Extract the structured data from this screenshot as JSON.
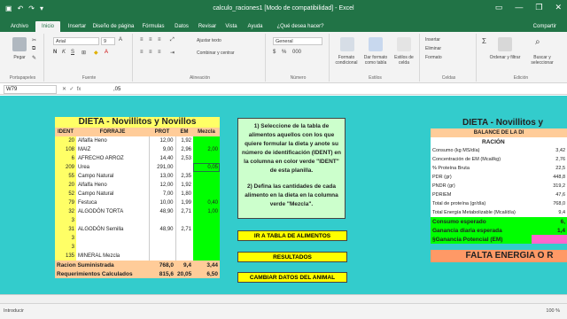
{
  "window": {
    "title": "calculo_raciones1 [Modo de compatibilidad] - Excel",
    "share": "Compartir"
  },
  "ribbon_tabs": [
    "Archivo",
    "Inicio",
    "Insertar",
    "Diseño de página",
    "Fórmulas",
    "Datos",
    "Revisar",
    "Vista",
    "Ayuda",
    "¿Qué desea hacer?"
  ],
  "ribbon": {
    "paste": "Pegar",
    "clipboard": "Portapapeles",
    "font_name": "Arial",
    "font_size": "9",
    "font_group": "Fuente",
    "wrap": "Ajustar texto",
    "merge": "Combinar y centrar",
    "align_group": "Alineación",
    "number_format": "General",
    "number_group": "Número",
    "cond_format": "Formato condicional",
    "table_format": "Dar formato como tabla",
    "cell_styles": "Estilos de celda",
    "styles_group": "Estilos",
    "insert": "Insertar",
    "delete": "Eliminar",
    "format": "Formato",
    "cells_group": "Celdas",
    "sort": "Ordenar y filtrar",
    "find": "Buscar y seleccionar",
    "edit_group": "Edición"
  },
  "formula_bar": {
    "name_box": "W79",
    "formula": ",05"
  },
  "diet": {
    "title": "DIETA - Novillitos y Novillos",
    "headers": [
      "IDENT",
      "FORRAJE",
      "PROT",
      "EM",
      "Mezcla"
    ],
    "rows": [
      [
        "20",
        "Alfalfa Heno",
        "12,00",
        "1,92",
        ""
      ],
      [
        "108",
        "MAIZ",
        "9,00",
        "2,96",
        "2,00"
      ],
      [
        "6",
        "AFRECHO ARROZ",
        "14,40",
        "2,53",
        ""
      ],
      [
        "209",
        "Urea",
        "291,00",
        "",
        "0,05"
      ],
      [
        "55",
        "Campo Natural",
        "13,00",
        "2,35",
        ""
      ],
      [
        "20",
        "Alfalfa Heno",
        "12,00",
        "1,92",
        ""
      ],
      [
        "52",
        "Campo Natural",
        "7,00",
        "1,80",
        ""
      ],
      [
        "79",
        "Festuca",
        "10,00",
        "1,99",
        "0,40"
      ],
      [
        "32",
        "ALGODÓN TORTA",
        "48,90",
        "2,71",
        "1,00"
      ],
      [
        "3",
        "",
        "",
        "",
        ""
      ],
      [
        "31",
        "ALGODÓN Semilla",
        "48,90",
        "2,71",
        ""
      ],
      [
        "3",
        "",
        "",
        "",
        ""
      ],
      [
        "3",
        "",
        "",
        "",
        ""
      ],
      [
        "135",
        "MINERAL Mezcla",
        "",
        "",
        ""
      ]
    ],
    "supplied_label": "Racion Suministrada",
    "supplied": [
      "768,0",
      "9,4",
      "3,44"
    ],
    "required_label": "Requerimientos Calculados",
    "required": [
      "815,6",
      "20,05",
      "6,50"
    ]
  },
  "instructions": {
    "p1": "1) Seleccione de la tabla de alimentos aquellos con los que quiere formular la dieta y anote su número de identificación (IDENT) en la columna en color verde \"IDENT\" de esta planilla.",
    "p2": "2) Defina las cantidades de cada alimento en la dieta en la columna verde \"Mezcla\"."
  },
  "buttons": {
    "tabla": "IR A TABLA DE ALIMENTOS",
    "resultados": "RESULTADOS",
    "cambiar": "CAMBIAR DATOS DEL ANIMAL"
  },
  "balance": {
    "title": "DIETA - Novillitos y",
    "header": "BALANCE DE LA DI",
    "racion": "RACIÓN",
    "rows": [
      [
        "Consumo (kg MS/día)",
        "3,42"
      ],
      [
        "Concentración de EM (Mcal/kg)",
        "2,76"
      ],
      [
        "% Proteína Bruta",
        "22,5"
      ],
      [
        "PDR (gr)",
        "448,8"
      ],
      [
        "PNDR (gr)",
        "319,2"
      ],
      [
        "PDRIEM",
        "47,6"
      ],
      [
        "Total de proteína (gr/día)",
        "768,0"
      ],
      [
        "Total Energía Metabolizable (Mcal/día)",
        "9,4"
      ]
    ],
    "consumo_label": "Consumo esperado",
    "consumo": "6,",
    "ganancia_label": "Ganancia diaria esperada",
    "ganancia": "1,4",
    "potencial_label": "§Ganancia Potencial (EM)",
    "potencial": "",
    "falta": "FALTA ENERGIA O R"
  },
  "status": {
    "mode": "Introducir",
    "zoom": "100 %"
  }
}
